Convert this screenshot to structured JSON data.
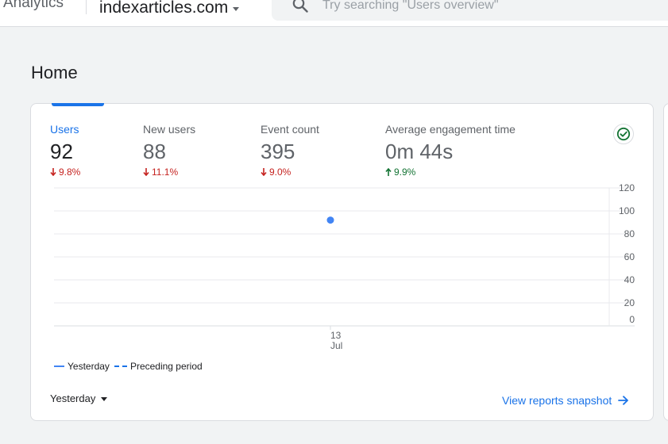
{
  "header": {
    "app_name": "Analytics",
    "property": "indexarticles.com",
    "search_placeholder": "Try searching \"Users overview\""
  },
  "page": {
    "title": "Home"
  },
  "metrics": [
    {
      "label": "Users",
      "value": "92",
      "change": "9.8%",
      "direction": "down",
      "active": true
    },
    {
      "label": "New users",
      "value": "88",
      "change": "11.1%",
      "direction": "down",
      "active": false
    },
    {
      "label": "Event count",
      "value": "395",
      "change": "9.0%",
      "direction": "down",
      "active": false
    },
    {
      "label": "Average engagement time",
      "value": "0m 44s",
      "change": "9.9%",
      "direction": "up",
      "active": false
    }
  ],
  "chart_data": {
    "type": "line",
    "x": [
      "13 Jul"
    ],
    "series": [
      {
        "name": "Yesterday",
        "values": [
          92
        ]
      }
    ],
    "xlabel": "",
    "ylabel": "",
    "ylim": [
      0,
      120
    ],
    "yticks": [
      0,
      20,
      40,
      60,
      80,
      100,
      120
    ],
    "x_tick_day": "13",
    "x_tick_month": "Jul",
    "grid": true,
    "legend": "bottom-left"
  },
  "legend": {
    "current": "Yesterday",
    "previous": "Preceding period"
  },
  "footer": {
    "date_range": "Yesterday",
    "snapshot_link": "View reports snapshot"
  },
  "colors": {
    "accent": "#1a73e8",
    "series_point": "#4285f4",
    "negative": "#c5221f",
    "positive": "#137333",
    "status_ok": "#137333"
  },
  "icons": {
    "search": "search-icon",
    "status": "check-circle-icon",
    "arrow": "arrow-right-icon"
  }
}
